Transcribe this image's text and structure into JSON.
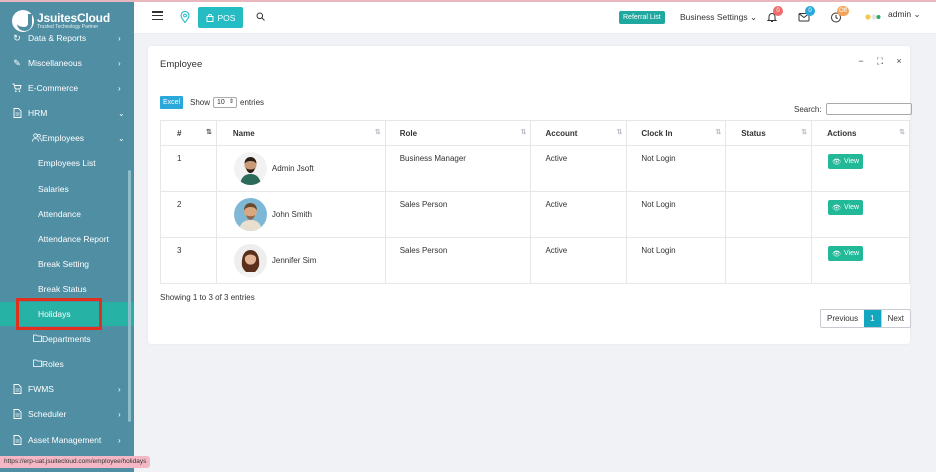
{
  "brand": {
    "name": "JsuitesCloud",
    "tagline": "Trusted Technology Partner"
  },
  "sidebar": {
    "items": [
      {
        "label": "Data & Reports",
        "icon": "refresh-icon"
      },
      {
        "label": "Miscellaneous",
        "icon": "edit-icon"
      },
      {
        "label": "E-Commerce",
        "icon": "cart-icon"
      },
      {
        "label": "HRM",
        "icon": "document-icon"
      },
      {
        "label": "Employees",
        "icon": "users-icon"
      },
      {
        "label": "Employees List"
      },
      {
        "label": "Salaries"
      },
      {
        "label": "Attendance"
      },
      {
        "label": "Attendance Report"
      },
      {
        "label": "Break Setting"
      },
      {
        "label": "Break Status"
      },
      {
        "label": "Holidays"
      },
      {
        "label": "Departments",
        "icon": "folder-icon"
      },
      {
        "label": "Roles",
        "icon": "folder-icon"
      },
      {
        "label": "FWMS",
        "icon": "document-icon"
      },
      {
        "label": "Scheduler",
        "icon": "document-icon"
      },
      {
        "label": "Asset Management",
        "icon": "document-icon"
      }
    ]
  },
  "header": {
    "pos_label": "POS",
    "referral_label": "Referral List",
    "business_settings_label": "Business Settings",
    "notifications_count": "0",
    "messages_count": "0",
    "clock_status": "Off",
    "user_name": "admin",
    "colors": {
      "accent": "#26bcc4",
      "referral": "#1fa8a0"
    }
  },
  "card": {
    "title": "Employee",
    "excel_label": "Excel",
    "show_label": "Show",
    "entries_value": "10",
    "entries_label": "entries",
    "search_label": "Search:",
    "columns": [
      "#",
      "Name",
      "Role",
      "Account",
      "Clock In",
      "Status",
      "Actions"
    ],
    "rows": [
      {
        "index": "1",
        "name": "Admin Jsoft",
        "role": "Business Manager",
        "account": "Active",
        "clock_in": "Not Login",
        "status": "",
        "action": "View"
      },
      {
        "index": "2",
        "name": "John Smith",
        "role": "Sales Person",
        "account": "Active",
        "clock_in": "Not Login",
        "status": "",
        "action": "View"
      },
      {
        "index": "3",
        "name": "Jennifer Sim",
        "role": "Sales Person",
        "account": "Active",
        "clock_in": "Not Login",
        "status": "",
        "action": "View"
      }
    ],
    "showing_text": "Showing 1 to 3 of 3 entries",
    "pagination": {
      "previous": "Previous",
      "current": "1",
      "next": "Next"
    }
  },
  "status_url": "https://erp-uat.jsuitecloud.com/employee/holidays"
}
